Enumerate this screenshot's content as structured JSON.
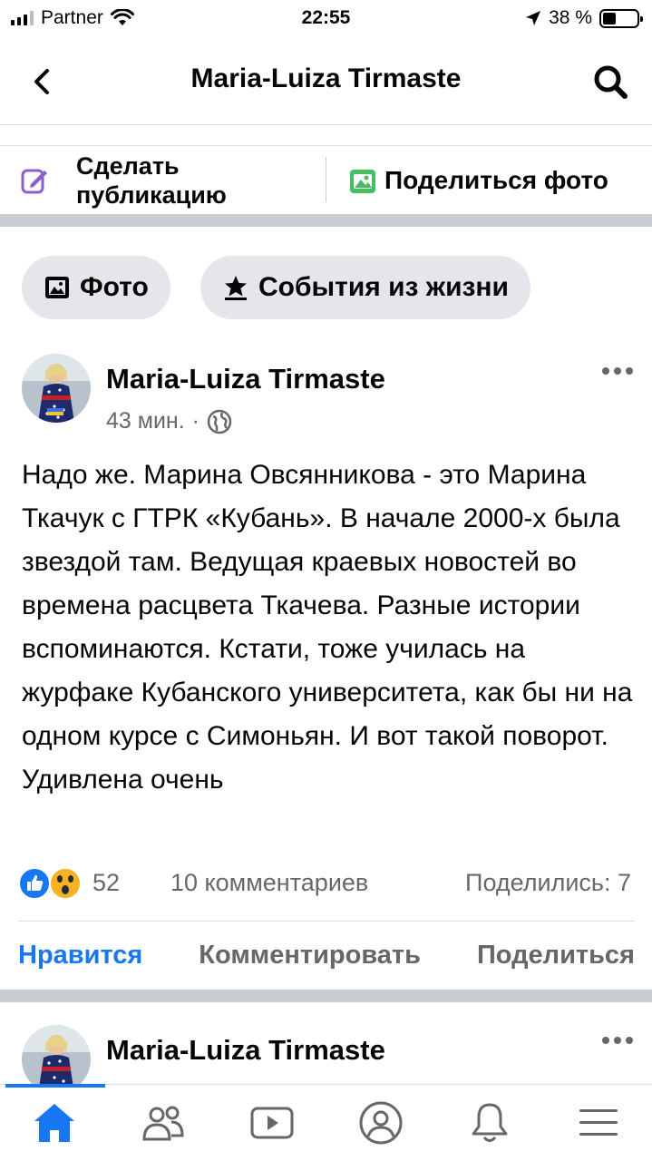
{
  "status_bar": {
    "carrier": "Partner",
    "time": "22:55",
    "battery": "38 %"
  },
  "header": {
    "title": "Maria-Luiza Tirmaste"
  },
  "composer": {
    "create_post": "Сделать публикацию",
    "share_photo": "Поделиться фото"
  },
  "chips": {
    "photo": "Фото",
    "life_events": "События из жизни"
  },
  "post": {
    "author": "Maria-Luiza Tirmaste",
    "time": "43 мин.",
    "dot": "·",
    "text": "Надо же. Марина Овсянникова - это Марина Ткачук с ГТРК «Кубань». В начале 2000-х была звездой там. Ведущая краевых новостей во времена расцвета Ткачева. Разные истории вспоминаются. Кстати, тоже училась на журфаке Кубанского университета, как бы ни на одном курсе с Симоньян. И вот такой поворот. Удивлена очень",
    "reaction_count": "52",
    "comments": "10 комментариев",
    "shares": "Поделились: 7",
    "actions": {
      "like": "Нравится",
      "comment": "Комментировать",
      "share": "Поделиться"
    }
  },
  "post2": {
    "author": "Maria-Luiza Tirmaste"
  },
  "colors": {
    "accent": "#1877f2",
    "separator": "#c9ccd1",
    "secondary_text": "#65676b"
  },
  "tabbar": {
    "icons": [
      "home-icon",
      "friends-icon",
      "watch-icon",
      "profile-icon",
      "notifications-icon",
      "menu-icon"
    ]
  }
}
